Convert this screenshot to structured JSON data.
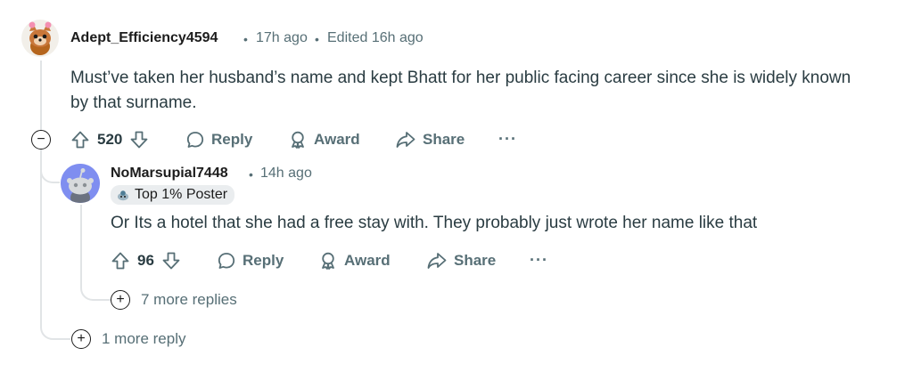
{
  "comment1": {
    "username": "Adept_Efficiency4594",
    "time": "17h ago",
    "edited": "Edited 16h ago",
    "body_line1": "Must’ve taken her husband’s name and kept Bhatt for her public facing career since she is widely known",
    "body_line2": "by that surname.",
    "votes": "520",
    "reply_label": "Reply",
    "award_label": "Award",
    "share_label": "Share",
    "more_label": "···",
    "collapse_label": "−",
    "more_reply_label": "1 more reply",
    "avatar_icon": "snoo-avatar-icon"
  },
  "comment2": {
    "username": "NoMarsupial7448",
    "time": "14h ago",
    "flair": "Top 1% Poster",
    "body": "Or Its a hotel that she had a free stay with. They probably just wrote her name like that",
    "votes": "96",
    "reply_label": "Reply",
    "award_label": "Award",
    "share_label": "Share",
    "more_label": "···",
    "more_replies_label": "7 more replies",
    "avatar_icon": "snoo-avatar-icon"
  },
  "separator": "•",
  "expand_label": "+"
}
